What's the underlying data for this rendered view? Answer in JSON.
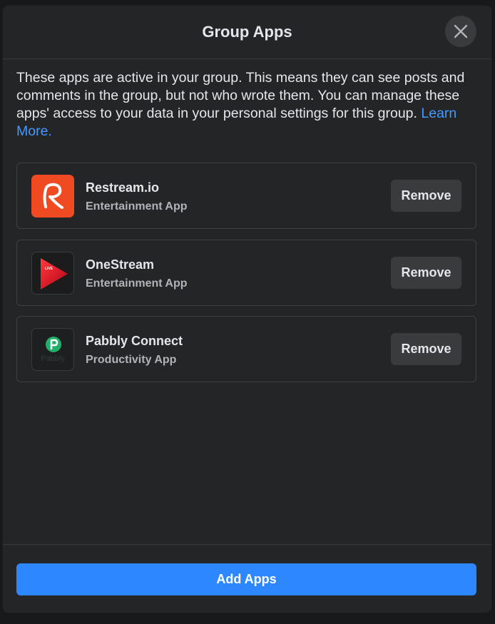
{
  "dialog": {
    "title": "Group Apps",
    "description": "These apps are active in your group. This means they can see posts and comments in the group, but not who wrote them. You can manage these apps' access to your data in your personal settings for this group.",
    "learn_more": "Learn More."
  },
  "apps": [
    {
      "name": "Restream.io",
      "category": "Entertainment App",
      "icon": "restream-logo-icon",
      "remove_label": "Remove"
    },
    {
      "name": "OneStream",
      "category": "Entertainment App",
      "icon": "onestream-logo-icon",
      "remove_label": "Remove",
      "icon_text": "LIVE"
    },
    {
      "name": "Pabbly Connect",
      "category": "Productivity App",
      "icon": "pabbly-logo-icon",
      "remove_label": "Remove",
      "icon_text": "Pabbly"
    }
  ],
  "footer": {
    "add_label": "Add Apps"
  },
  "colors": {
    "accent": "#2d88ff",
    "link": "#4599ff",
    "surface": "#242526",
    "restream": "#f04a23"
  }
}
